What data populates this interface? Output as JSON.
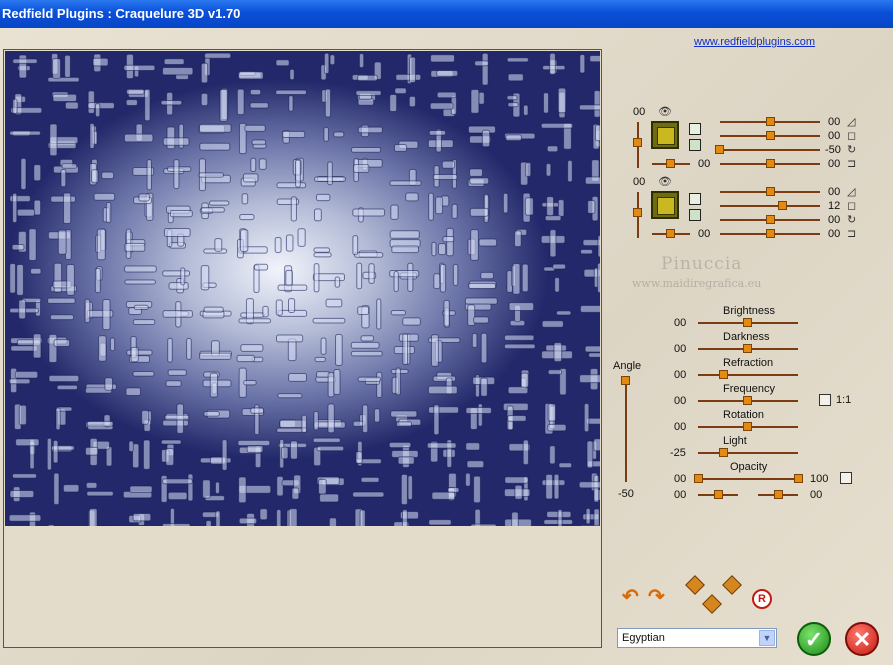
{
  "window": {
    "title": "Redfield Plugins : Craquelure 3D  v1.70"
  },
  "header": {
    "link": "www.redfieldplugins.com"
  },
  "layers": [
    {
      "top_value": "00",
      "rows": [
        {
          "value": "00",
          "icon": "triangle-icon"
        },
        {
          "value": "00",
          "icon": "square-icon"
        },
        {
          "value": "-50",
          "icon": "rotate-icon"
        },
        {
          "left_value": "00",
          "value": "00",
          "icon": "corner-icon"
        }
      ]
    },
    {
      "top_value": "00",
      "rows": [
        {
          "value": "00",
          "icon": "triangle-icon"
        },
        {
          "value": "12",
          "icon": "square-icon"
        },
        {
          "value": "00",
          "icon": "rotate-icon"
        },
        {
          "left_value": "00",
          "value": "00",
          "icon": "corner-icon"
        }
      ]
    }
  ],
  "watermark": {
    "name": "Pinuccia",
    "url": "www.maidiregrafica.eu"
  },
  "controls": {
    "angle_label": "Angle",
    "angle_value": "-50",
    "brightness": {
      "label": "Brightness",
      "value": "00"
    },
    "darkness": {
      "label": "Darkness",
      "value": "00"
    },
    "refraction": {
      "label": "Refraction",
      "value": "00"
    },
    "frequency": {
      "label": "Frequency",
      "value": "00"
    },
    "ratio_label": "1:1",
    "rotation": {
      "label": "Rotation",
      "value": "00"
    },
    "light": {
      "label": "Light",
      "value": "-25"
    },
    "opacity": {
      "label": "Opacity",
      "left_value": "00",
      "right_value": "100"
    },
    "bottom": {
      "left_value": "00",
      "right_value": "00"
    }
  },
  "preset": {
    "selected": "Egyptian"
  },
  "actions": {
    "reset_label": "R"
  },
  "colors": {
    "titlebar": "#0a4fd8",
    "accent": "#e48a10",
    "ok": "#1d8b18",
    "cancel": "#c41a12"
  }
}
